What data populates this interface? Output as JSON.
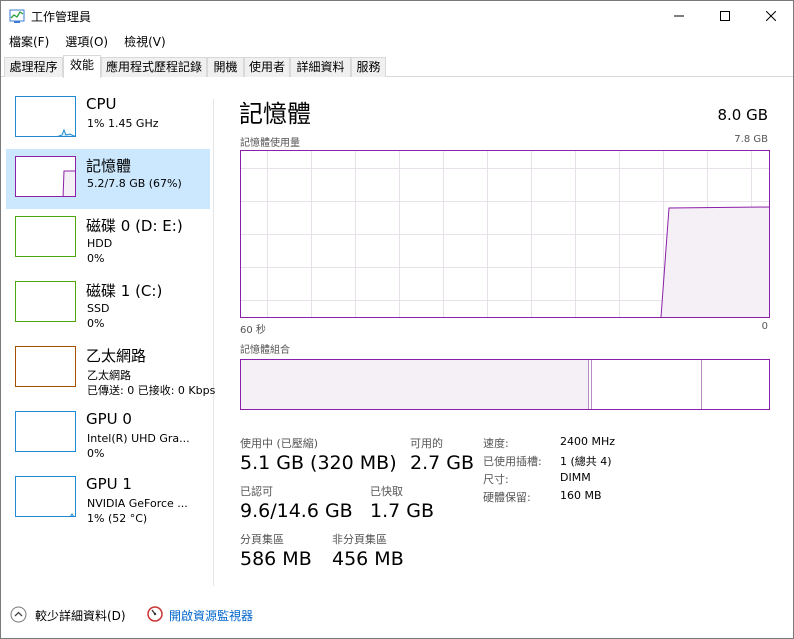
{
  "window": {
    "title": "工作管理員",
    "min_glyph": "—",
    "max_glyph": "☐",
    "close_glyph": "✕"
  },
  "menu": [
    "檔案(F)",
    "選項(O)",
    "檢視(V)"
  ],
  "tabs": [
    {
      "label": "處理程序",
      "active": false
    },
    {
      "label": "效能",
      "active": true
    },
    {
      "label": "應用程式歷程記錄",
      "active": false
    },
    {
      "label": "開機",
      "active": false
    },
    {
      "label": "使用者",
      "active": false
    },
    {
      "label": "詳細資料",
      "active": false
    },
    {
      "label": "服務",
      "active": false
    }
  ],
  "sidebar": {
    "items": [
      {
        "title": "CPU",
        "sub1": "1% 1.45 GHz",
        "sub2": "",
        "color": "#1f8ad1"
      },
      {
        "title": "記憶體",
        "sub1": "5.2/7.8 GB (67%)",
        "sub2": "",
        "color": "#8b1fa9"
      },
      {
        "title": "磁碟 0 (D: E:)",
        "sub1": "HDD",
        "sub2": "0%",
        "color": "#4da60c"
      },
      {
        "title": "磁碟 1 (C:)",
        "sub1": "SSD",
        "sub2": "0%",
        "color": "#4da60c"
      },
      {
        "title": "乙太網路",
        "sub1": "乙太網路",
        "sub2": "已傳送: 0 已接收: 0 Kbps",
        "color": "#a74f01"
      },
      {
        "title": "GPU 0",
        "sub1": "Intel(R) UHD Gra...",
        "sub2": "0%",
        "color": "#1f8ad1"
      },
      {
        "title": "GPU 1",
        "sub1": "NVIDIA GeForce ...",
        "sub2": "1% (52 °C)",
        "color": "#1f8ad1"
      }
    ]
  },
  "main": {
    "title": "記憶體",
    "total": "8.0 GB",
    "usage_label": "記憶體使用量",
    "usage_max": "7.8 GB",
    "time_left": "60 秒",
    "time_right": "0",
    "composition_label": "記憶體組合",
    "usage_fraction": 0.67,
    "stats": {
      "in_use_label": "使用中 (已壓縮)",
      "in_use_value": "5.1 GB (320 MB)",
      "available_label": "可用的",
      "available_value": "2.7 GB",
      "committed_label": "已認可",
      "committed_value": "9.6/14.6 GB",
      "cached_label": "已快取",
      "cached_value": "1.7 GB",
      "paged_label": "分頁集區",
      "paged_value": "586 MB",
      "nonpaged_label": "非分頁集區",
      "nonpaged_value": "456 MB"
    },
    "specs": {
      "speed_label": "速度:",
      "speed_value": "2400 MHz",
      "slots_label": "已使用插槽:",
      "slots_value": "1 (總共 4)",
      "form_label": "尺寸:",
      "form_value": "DIMM",
      "reserved_label": "硬體保留:",
      "reserved_value": "160 MB"
    }
  },
  "footer": {
    "fewer_details": "較少詳細資料(D)",
    "resource_monitor": "開啟資源監視器"
  },
  "colors": {
    "memory": "#8b1fa9",
    "memory_fill": "#f4f0f5",
    "cpu": "#1f8ad1",
    "disk": "#4da60c",
    "ethernet": "#a74f01",
    "selected_bg": "#cce8ff",
    "link": "#0066cc"
  }
}
